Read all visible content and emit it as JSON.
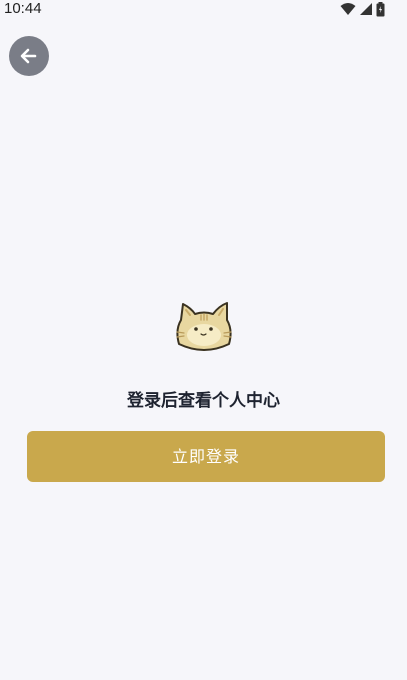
{
  "status_bar": {
    "time": "10:44",
    "icons": [
      "wifi-icon",
      "signal-icon",
      "battery-icon"
    ]
  },
  "header": {
    "back_icon": "arrow-left-icon"
  },
  "profile": {
    "mascot_icon": "cat-mascot-icon",
    "prompt": "登录后查看个人中心",
    "login_button_label": "立即登录"
  },
  "colors": {
    "background": "#f6f6fa",
    "accent": "#c9a84c",
    "back_button": "#7a7d87"
  }
}
